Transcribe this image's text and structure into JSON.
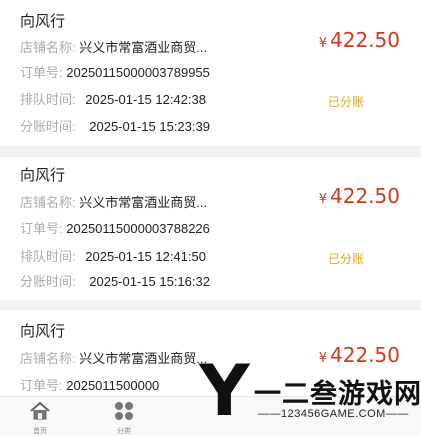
{
  "records": [
    {
      "title": "向风行",
      "shop_label": "店铺名称:",
      "shop_value": "兴义市常富酒业商贸...",
      "order_label": "订单号:",
      "order_value": "20250115000003789955",
      "queue_label": "排队时间:",
      "queue_value": "2025-01-15 12:42:38",
      "split_label": "分账时间:",
      "split_value": "2025-01-15 15:23:39",
      "currency": "¥",
      "amount": "422.50",
      "status": "已分账"
    },
    {
      "title": "向风行",
      "shop_label": "店铺名称:",
      "shop_value": "兴义市常富酒业商贸...",
      "order_label": "订单号:",
      "order_value": "20250115000003788226",
      "queue_label": "排队时间:",
      "queue_value": "2025-01-15 12:41:50",
      "split_label": "分账时间:",
      "split_value": "2025-01-15 15:16:32",
      "currency": "¥",
      "amount": "422.50",
      "status": "已分账"
    },
    {
      "title": "向风行",
      "shop_label": "店铺名称:",
      "shop_value": "兴义市常富酒业商贸...",
      "order_label": "订单号:",
      "order_value": "2025011500000",
      "currency": "¥",
      "amount": "422.50"
    }
  ],
  "bottom_nav": {
    "home_label": "首页",
    "second_label": "分类"
  },
  "watermark": {
    "letter": "Y",
    "title": "一二叁游戏网",
    "site": "——123456GAME.COM——"
  }
}
